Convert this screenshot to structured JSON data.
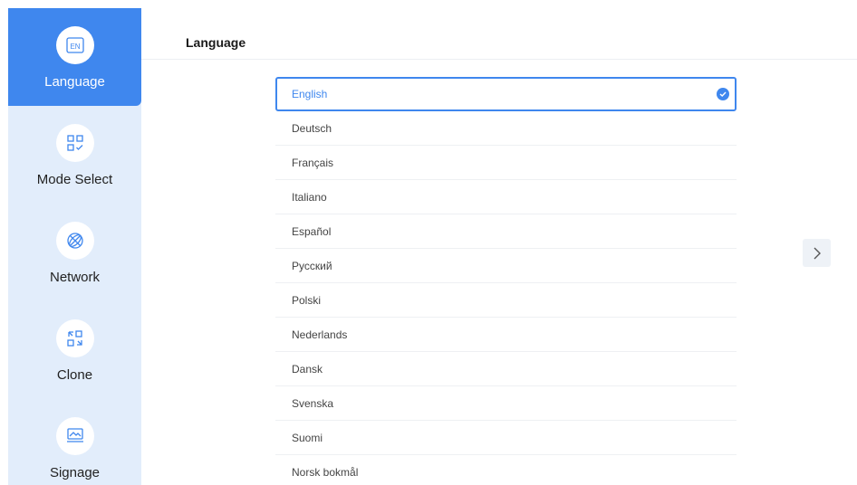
{
  "sidebar": {
    "items": [
      {
        "label": "Language",
        "icon": "en-icon",
        "active": true,
        "icon_text": "EN"
      },
      {
        "label": "Mode Select",
        "icon": "mode-select-icon",
        "active": false
      },
      {
        "label": "Network",
        "icon": "globe-icon",
        "active": false
      },
      {
        "label": "Clone",
        "icon": "clone-icon",
        "active": false
      },
      {
        "label": "Signage",
        "icon": "signage-icon",
        "active": false
      }
    ]
  },
  "header": {
    "title": "Language"
  },
  "languages": {
    "selected": "English",
    "items": [
      "English",
      "Deutsch",
      "Français",
      "Italiano",
      "Español",
      "Русский",
      "Polski",
      "Nederlands",
      "Dansk",
      "Svenska",
      "Suomi",
      "Norsk bokmål"
    ]
  },
  "colors": {
    "accent": "#3f87ee",
    "sidebar_bg": "#e2edfb"
  }
}
